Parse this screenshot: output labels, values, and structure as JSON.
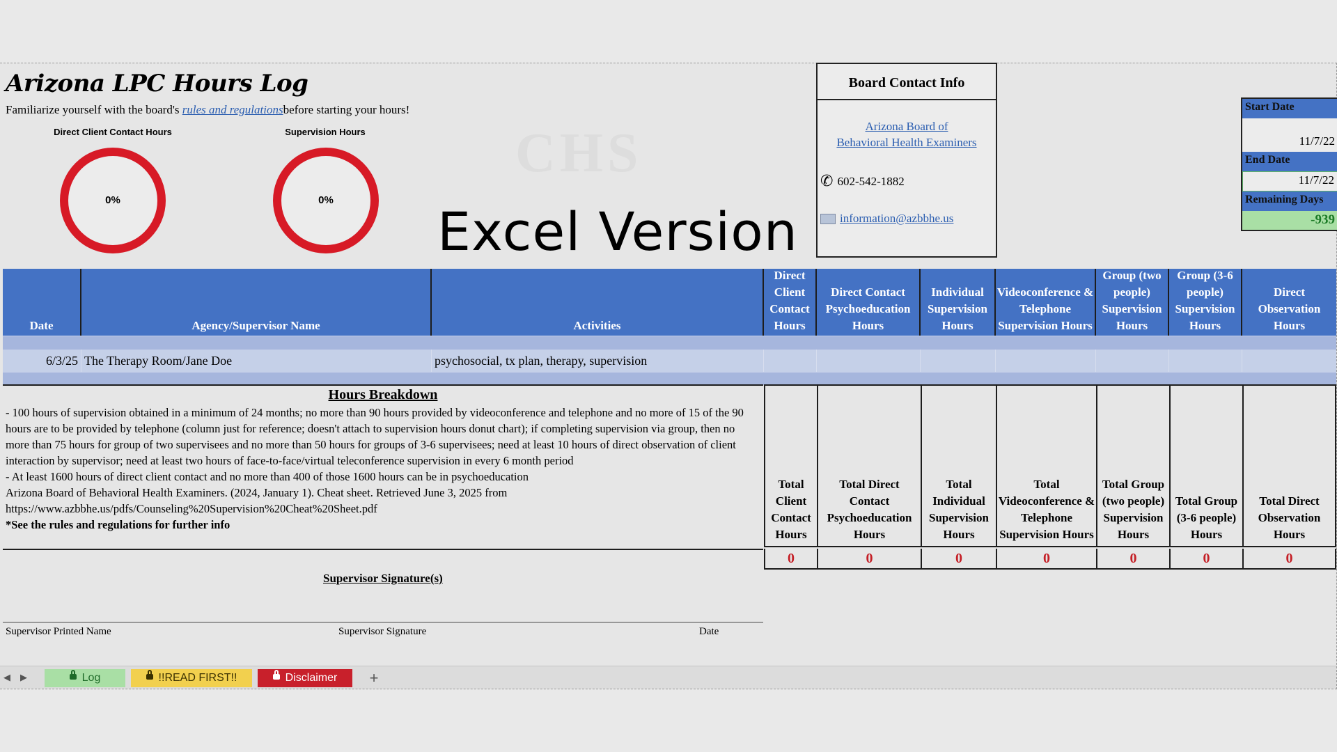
{
  "title": "Arizona LPC Hours Log",
  "intro": {
    "before": "Familiarize yourself with the board's ",
    "link": "rules and regulations",
    "after": "before starting your hours!"
  },
  "donuts": [
    {
      "label": "Direct Client Contact Hours",
      "value_text": "0%",
      "value": 0
    },
    {
      "label": "Supervision Hours",
      "value_text": "0%",
      "value": 0
    }
  ],
  "watermark": "CHS",
  "excel_version": "Excel Version",
  "board": {
    "heading": "Board Contact Info",
    "link_line1": "Arizona Board of",
    "link_line2": "Behavioral Health Examiners",
    "phone": "602-542-1882",
    "email": "information@azbbhe.us"
  },
  "dates": {
    "start_label": "Start Date",
    "start_value": "11/7/22",
    "end_label": "End Date",
    "end_value": "11/7/22",
    "remaining_label": "Remaining Days",
    "remaining_value": "-939"
  },
  "table": {
    "headers": [
      "Date",
      "Agency/Supervisor Name",
      "Activities",
      "Direct Client Contact Hours",
      "Direct Contact Psychoeducation Hours",
      "Individual Supervision Hours",
      "Videoconference & Telephone Supervision Hours",
      "Group (two people) Supervision Hours",
      "Group (3-6 people) Supervision Hours",
      "Direct Observation Hours"
    ],
    "row": {
      "date": "6/3/25",
      "agency": "The Therapy Room/Jane Doe",
      "activities": "psychosocial, tx plan, therapy, supervision"
    }
  },
  "breakdown": {
    "title": "Hours Breakdown",
    "p1": "- 100 hours of supervision obtained in a minimum of 24 months; no more than 90 hours provided by videoconference and telephone and no more of 15 of the 90 hours are to be provided by telephone (column just for reference; doesn't attach to supervision hours donut chart); if completing supervision via group, then no more than 75 hours for group of two supervisees and no more than 50 hours for groups of 3-6 supervisees; need at least 10 hours of direct observation of client interaction by supervisor; need at least two hours of face-to-face/virtual teleconference supervision in every 6 month period",
    "p2": "- At least 1600 hours of direct client contact and no more than 400 of those 1600 hours can be in psychoeducation",
    "p3": "Arizona Board of Behavioral Health Examiners. (2024, January 1). Cheat sheet. Retrieved June 3, 2025 from https://www.azbbhe.us/pdfs/Counseling%20Supervision%20Cheat%20Sheet.pdf",
    "p4": "*See the rules and regulations for further info"
  },
  "totals": [
    {
      "label": "Total Client Contact Hours",
      "value": "0"
    },
    {
      "label": "Total Direct Contact Psychoeducation Hours",
      "value": "0"
    },
    {
      "label": "Total Individual Supervision Hours",
      "value": "0"
    },
    {
      "label": "Total Videoconference & Telephone Supervision Hours",
      "value": "0"
    },
    {
      "label": "Total Group (two people) Supervision Hours",
      "value": "0"
    },
    {
      "label": "Total Group (3-6 people) Hours",
      "value": "0"
    },
    {
      "label": "Total Direct Observation Hours",
      "value": "0"
    }
  ],
  "signature": {
    "title": "Supervisor Signature(s)",
    "printed_name": "Supervisor Printed Name",
    "signature": "Supervisor Signature",
    "date": "Date"
  },
  "tabs": [
    {
      "label": "Log",
      "bg": "#a9dfa5",
      "color": "#1e6b28"
    },
    {
      "label": "!!READ FIRST!!",
      "bg": "#f2d04e",
      "color": "#3a3000"
    },
    {
      "label": "Disclaimer",
      "bg": "#c8202b",
      "color": "#ffffff"
    }
  ],
  "add_tab": "+",
  "colors": {
    "header_blue": "#4472c4",
    "donut_red": "#d71a26",
    "total_red": "#c41e25"
  }
}
